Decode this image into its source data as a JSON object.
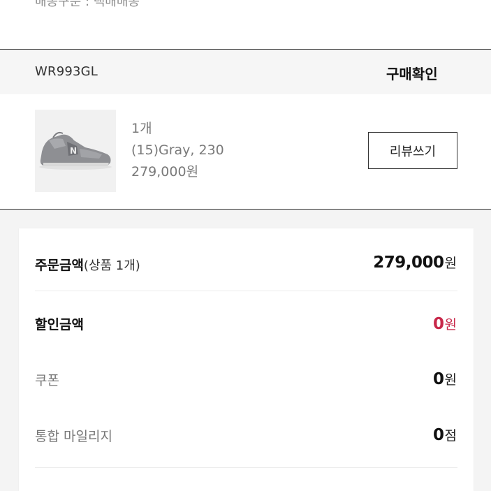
{
  "shipping": {
    "text": "배송구분 : 택배배송"
  },
  "order": {
    "product_code": "WR993GL",
    "status": "구매확인",
    "item": {
      "quantity": "1개",
      "option": "(15)Gray, 230",
      "price": "279,000원"
    },
    "review_button": "리뷰쓰기"
  },
  "summary": {
    "order_amount": {
      "label": "주문금액",
      "suffix": "(상품 1개)",
      "value": "279,000",
      "unit": "원"
    },
    "discount": {
      "label": "할인금액",
      "value": "0",
      "unit": "원"
    },
    "coupon": {
      "label": "쿠폰",
      "value": "0",
      "unit": "원"
    },
    "mileage": {
      "label": "통합 마일리지",
      "value": "0",
      "unit": "점"
    }
  },
  "colors": {
    "discount_red": "#c8284a",
    "divider": "#2e2e2e"
  },
  "icons": {
    "product_image": "gray-sneaker-image"
  }
}
